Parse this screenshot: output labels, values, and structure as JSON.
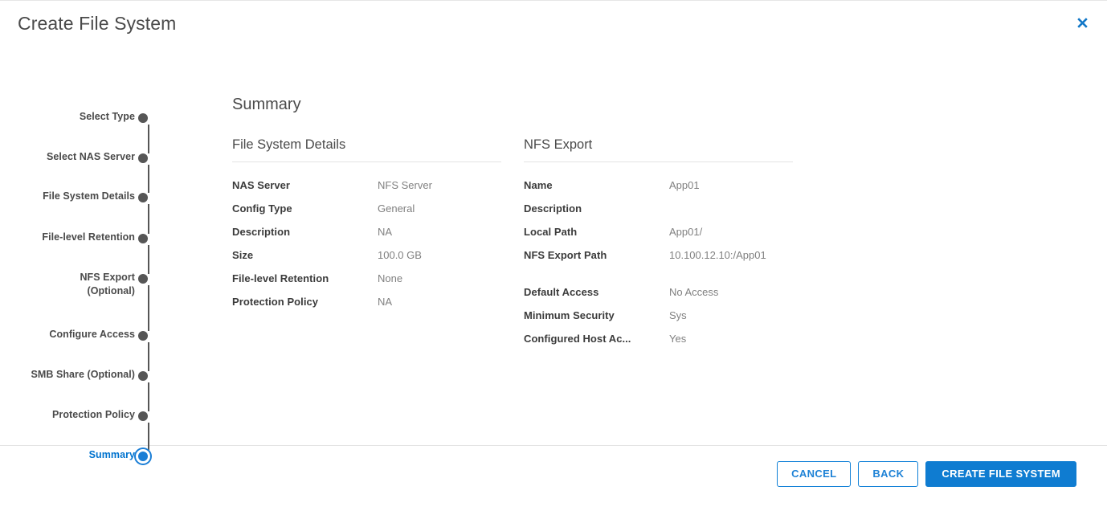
{
  "dialog": {
    "title": "Create File System",
    "close_icon": "close-icon"
  },
  "stepper": {
    "steps": [
      {
        "label": "Select Type",
        "state": "complete"
      },
      {
        "label": "Select NAS Server",
        "state": "complete"
      },
      {
        "label": "File System Details",
        "state": "complete"
      },
      {
        "label": "File-level Retention",
        "state": "complete"
      },
      {
        "label": "NFS Export\n(Optional)",
        "state": "complete"
      },
      {
        "label": "Configure Access",
        "state": "complete"
      },
      {
        "label": "SMB Share (Optional)",
        "state": "complete"
      },
      {
        "label": "Protection Policy",
        "state": "complete"
      },
      {
        "label": "Summary",
        "state": "active"
      }
    ]
  },
  "main": {
    "heading": "Summary",
    "sections": [
      {
        "heading": "File System Details",
        "rows": [
          {
            "key": "NAS Server",
            "value": "NFS Server"
          },
          {
            "key": "Config Type",
            "value": "General"
          },
          {
            "key": "Description",
            "value": "NA"
          },
          {
            "key": "Size",
            "value": "100.0 GB"
          },
          {
            "key": "File-level Retention",
            "value": "None"
          },
          {
            "key": "Protection Policy",
            "value": "NA"
          }
        ]
      },
      {
        "heading": "NFS Export",
        "rows": [
          {
            "key": "Name",
            "value": "App01"
          },
          {
            "key": "Description",
            "value": ""
          },
          {
            "key": "Local Path",
            "value": "App01/"
          },
          {
            "key": "NFS Export Path",
            "value": "10.100.12.10:/App01"
          },
          {
            "key": "",
            "value": "",
            "spacer": true
          },
          {
            "key": "Default Access",
            "value": "No Access"
          },
          {
            "key": "Minimum Security",
            "value": "Sys"
          },
          {
            "key": "Configured Host Ac...",
            "value": "Yes"
          }
        ]
      }
    ]
  },
  "footer": {
    "cancel_label": "CANCEL",
    "back_label": "BACK",
    "submit_label": "CREATE FILE SYSTEM"
  },
  "colors": {
    "accent": "#0f7cd1",
    "link": "#1e82d6",
    "step_dot": "#565656",
    "text": "#4a4a4a",
    "value_text": "#808080"
  }
}
